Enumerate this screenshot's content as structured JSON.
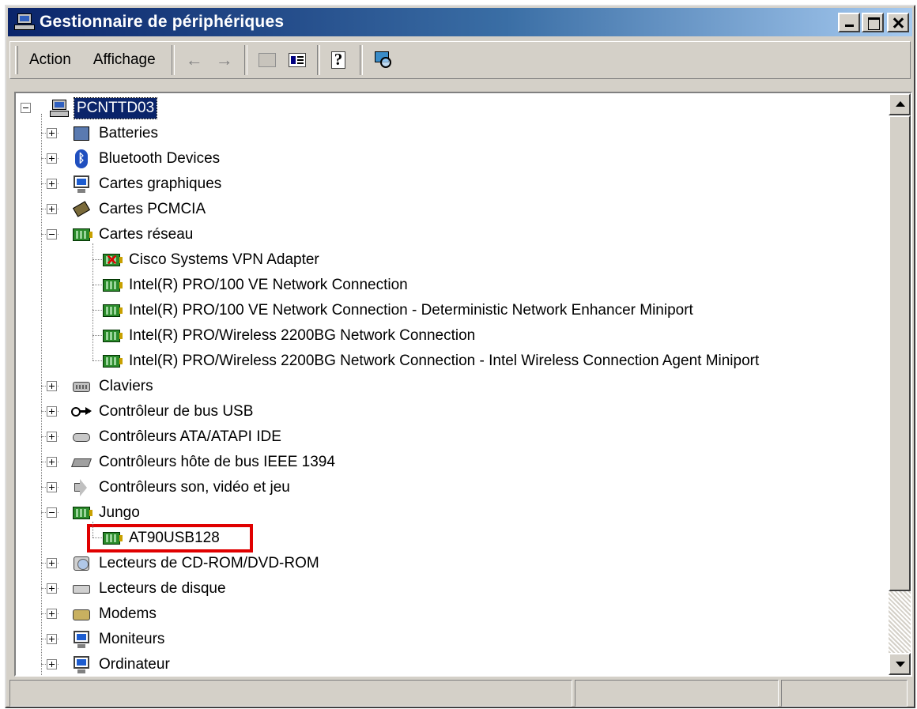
{
  "window": {
    "title": "Gestionnaire de périphériques"
  },
  "menu": [
    {
      "label": "Action"
    },
    {
      "label": "Affichage"
    }
  ],
  "tree": {
    "root": "PCNTTD03",
    "categories": [
      {
        "label": "Batteries",
        "expanded": false,
        "icon": "battery-icon"
      },
      {
        "label": "Bluetooth Devices",
        "expanded": false,
        "icon": "bluetooth-icon"
      },
      {
        "label": "Cartes graphiques",
        "expanded": false,
        "icon": "monitor-icon"
      },
      {
        "label": "Cartes PCMCIA",
        "expanded": false,
        "icon": "pcmcia-icon"
      },
      {
        "label": "Cartes réseau",
        "expanded": true,
        "icon": "network-card-icon",
        "children": [
          {
            "label": "Cisco Systems VPN Adapter",
            "icon": "network-card-error-icon"
          },
          {
            "label": "Intel(R) PRO/100 VE Network Connection",
            "icon": "network-card-icon"
          },
          {
            "label": "Intel(R) PRO/100 VE Network Connection - Deterministic Network Enhancer Miniport",
            "icon": "network-card-icon"
          },
          {
            "label": "Intel(R) PRO/Wireless 2200BG Network Connection",
            "icon": "network-card-icon"
          },
          {
            "label": "Intel(R) PRO/Wireless 2200BG Network Connection - Intel Wireless Connection Agent Miniport",
            "icon": "network-card-icon"
          }
        ]
      },
      {
        "label": "Claviers",
        "expanded": false,
        "icon": "keyboard-icon"
      },
      {
        "label": "Contrôleur de bus USB",
        "expanded": false,
        "icon": "usb-icon"
      },
      {
        "label": "Contrôleurs ATA/ATAPI IDE",
        "expanded": false,
        "icon": "ide-icon"
      },
      {
        "label": "Contrôleurs hôte de bus IEEE 1394",
        "expanded": false,
        "icon": "ieee1394-icon"
      },
      {
        "label": "Contrôleurs son, vidéo et jeu",
        "expanded": false,
        "icon": "sound-icon"
      },
      {
        "label": "Jungo",
        "expanded": true,
        "icon": "network-card-icon",
        "children": [
          {
            "label": "AT90USB128",
            "icon": "network-card-icon",
            "highlighted": true
          }
        ]
      },
      {
        "label": "Lecteurs de CD-ROM/DVD-ROM",
        "expanded": false,
        "icon": "cdrom-icon"
      },
      {
        "label": "Lecteurs de disque",
        "expanded": false,
        "icon": "disk-icon"
      },
      {
        "label": "Modems",
        "expanded": false,
        "icon": "modem-icon"
      },
      {
        "label": "Moniteurs",
        "expanded": false,
        "icon": "monitor-icon"
      },
      {
        "label": "Ordinateur",
        "expanded": false,
        "icon": "monitor-icon"
      }
    ]
  },
  "colors": {
    "title_bar_start": "#0a246a",
    "title_bar_end": "#a6caf0",
    "selection": "#0a246a",
    "highlight_box": "#e00000",
    "window_face": "#d4d0c8"
  }
}
